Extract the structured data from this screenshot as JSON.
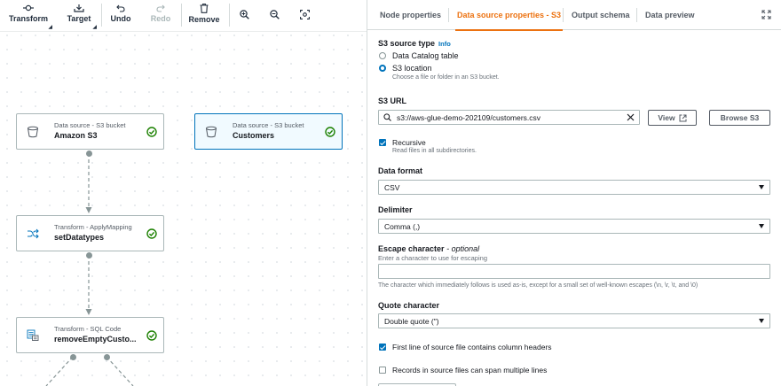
{
  "toolbar": {
    "transform_label": "Transform",
    "target_label": "Target",
    "undo_label": "Undo",
    "redo_label": "Redo",
    "remove_label": "Remove"
  },
  "nodes": [
    {
      "kind": "Data source - S3 bucket",
      "name": "Amazon S3",
      "icon": "bucket-icon",
      "status": "success"
    },
    {
      "kind": "Data source - S3 bucket",
      "name": "Customers",
      "icon": "bucket-icon",
      "status": "success",
      "selected": true
    },
    {
      "kind": "Transform - ApplyMapping",
      "name": "setDatatypes",
      "icon": "shuffle-icon",
      "status": "success"
    },
    {
      "kind": "Transform - SQL Code",
      "name": "removeEmptyCusto...",
      "icon": "sql-icon",
      "status": "success"
    }
  ],
  "tabs": [
    {
      "label": "Node properties"
    },
    {
      "label": "Data source properties - S3"
    },
    {
      "label": "Output schema"
    },
    {
      "label": "Data preview"
    }
  ],
  "form": {
    "source_type_label": "S3 source type",
    "info_link": "Info",
    "option_catalog": "Data Catalog table",
    "option_s3": "S3 location",
    "option_s3_desc": "Choose a file or folder in an S3 bucket.",
    "s3_url_label": "S3 URL",
    "s3_url_value": "s3://aws-glue-demo-202109/customers.csv",
    "view_button": "View",
    "browse_button": "Browse S3",
    "recursive_label": "Recursive",
    "recursive_desc": "Read files in all subdirectories.",
    "data_format_label": "Data format",
    "data_format_value": "CSV",
    "delimiter_label": "Delimiter",
    "delimiter_value": "Comma (,)",
    "escape_label": "Escape character",
    "escape_optional": "- optional",
    "escape_desc": "Enter a character to use for escaping",
    "escape_value": "",
    "escape_help": "The character which immediately follows is used as-is, except for a small set of well-known escapes (\\n, \\r, \\t, and \\0)",
    "quote_label": "Quote character",
    "quote_value": "Double quote (\")",
    "header_label": "First line of source file contains column headers",
    "multiline_label": "Records in source files can span multiple lines"
  },
  "colors": {
    "accent": "#ec7211",
    "link": "#0073bb",
    "success": "#1d8102"
  }
}
